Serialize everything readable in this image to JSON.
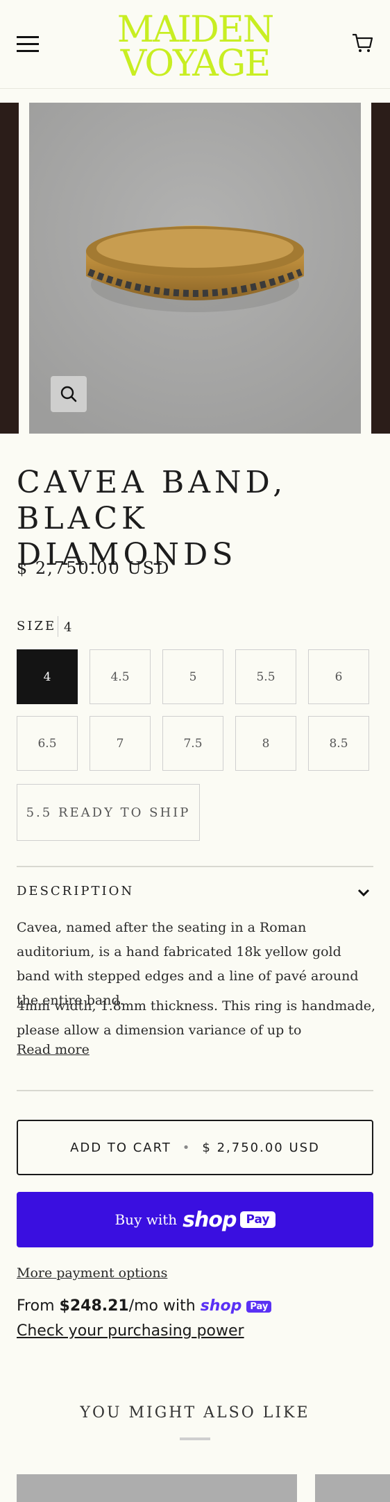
{
  "header": {
    "logo_line1": "MAIDEN",
    "logo_line2": "VOYAGE",
    "logo_color": "#c8ee22",
    "menu_icon": "hamburger-icon",
    "cart_icon": "cart-icon"
  },
  "gallery": {
    "zoom_icon": "search-icon"
  },
  "product": {
    "title": "CAVEA BAND, BLACK DIAMONDS",
    "price": "$ 2,750.00 USD",
    "size_label": "SIZE",
    "selected_size": "4",
    "sizes": [
      "4",
      "4.5",
      "5",
      "5.5",
      "6",
      "6.5",
      "7",
      "7.5",
      "8",
      "8.5"
    ],
    "ready_option": "5.5 READY TO SHIP"
  },
  "description": {
    "heading": "DESCRIPTION",
    "para1": "Cavea, named after the seating in a Roman auditorium, is a hand fabricated 18k yellow gold band with stepped edges and a line of pavé around the entire band.",
    "para2": "4mm width, 1.8mm thickness. This ring is handmade, please allow a dimension variance of up to",
    "read_more": "Read more"
  },
  "purchase": {
    "add_to_cart": "ADD TO CART",
    "add_to_cart_price": "$ 2,750.00 USD",
    "buy_with": "Buy with",
    "shop_word": "shop",
    "pay_word": "Pay",
    "more_payment": "More payment options",
    "installment_from": "From",
    "installment_amount": "$248.21",
    "installment_suffix": "/mo with",
    "check_power": "Check your purchasing power",
    "shop_pay_color": "#3a0fe0"
  },
  "recommendations": {
    "heading": "YOU MIGHT ALSO LIKE"
  }
}
